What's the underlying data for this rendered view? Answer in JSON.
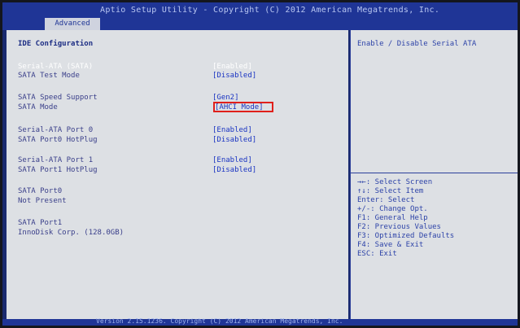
{
  "header": {
    "title": "Aptio Setup Utility - Copyright (C) 2012 American Megatrends, Inc.",
    "active_tab": "Advanced"
  },
  "main": {
    "section_title": "IDE Configuration",
    "rows": [
      {
        "label": "Serial-ATA (SATA)",
        "value": "[Enabled]"
      },
      {
        "label": "SATA Test Mode",
        "value": "[Disabled]"
      },
      {
        "label": "SATA Speed Support",
        "value": "[Gen2]"
      },
      {
        "label": "SATA Mode",
        "value": "[AHCI Mode]"
      },
      {
        "label": "Serial-ATA Port 0",
        "value": "[Enabled]"
      },
      {
        "label": "SATA Port0 HotPlug",
        "value": "[Disabled]"
      },
      {
        "label": "Serial-ATA Port 1",
        "value": "[Enabled]"
      },
      {
        "label": "SATA Port1 HotPlug",
        "value": "[Disabled]"
      }
    ],
    "port0_label": "SATA Port0",
    "port0_value": "Not Present",
    "port1_label": "SATA Port1",
    "port1_value": "InnoDisk Corp. (128.0GB)"
  },
  "help_panel": {
    "description": "Enable / Disable Serial ATA",
    "keys": [
      "→←: Select Screen",
      "↑↓: Select Item",
      "Enter: Select",
      "+/-: Change Opt.",
      "F1: General Help",
      "F2: Previous Values",
      "F3: Optimized Defaults",
      "F4: Save & Exit",
      "ESC: Exit"
    ]
  },
  "footer": {
    "text": "Version 2.15.1236. Copyright (C) 2012 American Megatrends, Inc."
  },
  "colors": {
    "frame": "#1a2a6e",
    "panel": "#dde0e4",
    "highlight": "#e0201b"
  }
}
